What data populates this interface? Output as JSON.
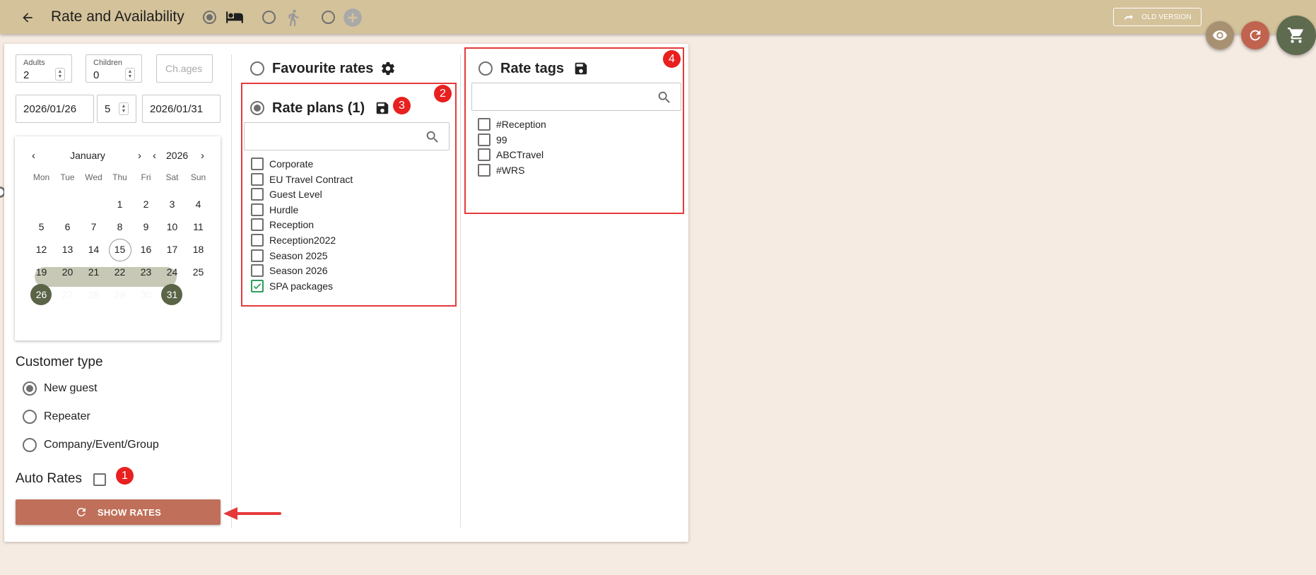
{
  "header": {
    "title": "Rate and Availability",
    "old_version_label": "OLD VERSION",
    "modes": [
      {
        "icon": "bed-icon",
        "selected": true
      },
      {
        "icon": "person-walking-icon",
        "selected": false
      },
      {
        "icon": "add-circle-icon",
        "selected": false
      }
    ]
  },
  "guests": {
    "adults_label": "Adults",
    "adults_value": "2",
    "children_label": "Children",
    "children_value": "0",
    "child_ages_placeholder": "Ch.ages"
  },
  "dates": {
    "arrival": "2026/01/26",
    "nights": "5",
    "departure": "2026/01/31"
  },
  "calendar": {
    "month": "January",
    "year": "2026",
    "weekdays": [
      "Mon",
      "Tue",
      "Wed",
      "Thu",
      "Fri",
      "Sat",
      "Sun"
    ],
    "weeks": [
      [
        "",
        "",
        "",
        "1",
        "2",
        "3",
        "4"
      ],
      [
        "5",
        "6",
        "7",
        "8",
        "9",
        "10",
        "11"
      ],
      [
        "12",
        "13",
        "14",
        "15",
        "16",
        "17",
        "18"
      ],
      [
        "19",
        "20",
        "21",
        "22",
        "23",
        "24",
        "25"
      ],
      [
        "26",
        "27",
        "28",
        "29",
        "30",
        "31",
        ""
      ]
    ],
    "today": "15",
    "range_start": "26",
    "range_end": "31"
  },
  "customer_type": {
    "title": "Customer type",
    "options": [
      "New guest",
      "Repeater",
      "Company/Event/Group"
    ],
    "selected": "New guest"
  },
  "auto_rates": {
    "label": "Auto Rates",
    "checked": false
  },
  "show_rates_label": "SHOW RATES",
  "favourite_rates": {
    "label": "Favourite rates"
  },
  "rate_plans": {
    "label": "Rate plans (1)",
    "items": [
      {
        "label": "Corporate",
        "checked": false
      },
      {
        "label": "EU Travel Contract",
        "checked": false
      },
      {
        "label": "Guest Level",
        "checked": false
      },
      {
        "label": "Hurdle",
        "checked": false
      },
      {
        "label": "Reception",
        "checked": false
      },
      {
        "label": "Reception2022",
        "checked": false
      },
      {
        "label": "Season 2025",
        "checked": false
      },
      {
        "label": "Season 2026",
        "checked": false
      },
      {
        "label": "SPA packages",
        "checked": true
      }
    ]
  },
  "rate_tags": {
    "label": "Rate tags",
    "items": [
      {
        "label": "#Reception",
        "checked": false
      },
      {
        "label": "99",
        "checked": false
      },
      {
        "label": "ABCTravel",
        "checked": false
      },
      {
        "label": "#WRS",
        "checked": false
      }
    ]
  },
  "annotations": [
    "1",
    "2",
    "3",
    "4"
  ],
  "colors": {
    "header_bg": "#d4c29a",
    "page_bg": "#f5ebe2",
    "accent": "#c0705a",
    "calendar_selected": "#5a6447",
    "annotation_red": "#e53a3a",
    "fab_eye": "#a89172",
    "fab_refresh": "#c0634f",
    "fab_cart": "#5f6b4e"
  }
}
